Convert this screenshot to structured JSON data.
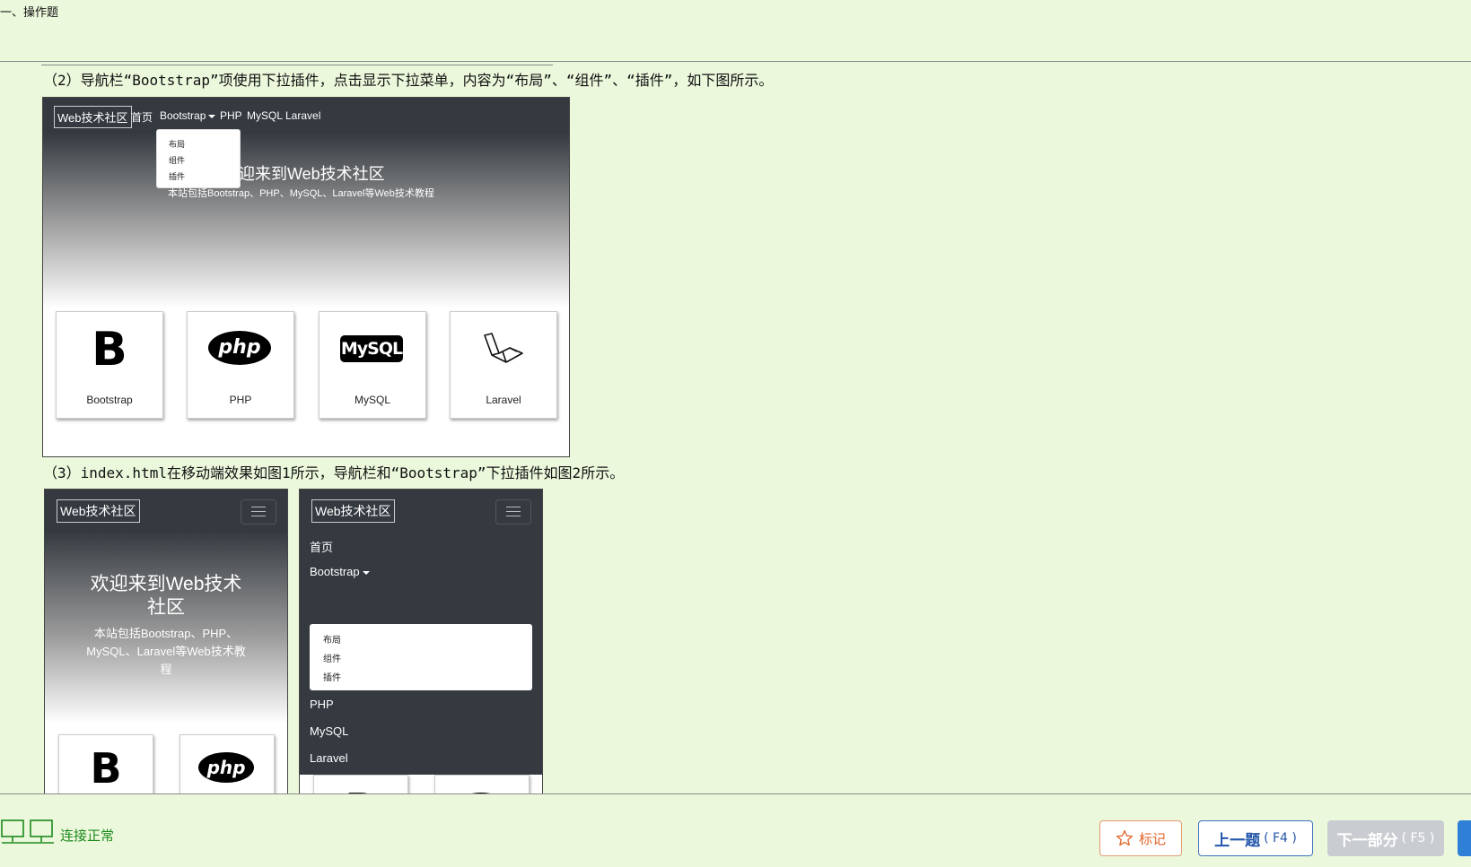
{
  "section_title": "一、操作题",
  "question2_text": "（2）导航栏“Bootstrap”项使用下拉插件，点击显示下拉菜单，内容为“布局”、“组件”、“插件”，如下图所示。",
  "question3_text": "（3）index.html在移动端效果如图1所示，导航栏和“Bootstrap”下拉插件如图2所示。",
  "desktop_shot": {
    "brand": "Web技术社区",
    "nav": [
      "首页",
      "Bootstrap",
      "PHP",
      "MySQL",
      "Laravel"
    ],
    "dropdown": [
      "布局",
      "组件",
      "插件"
    ],
    "hero_title": "迎来到Web技术社区",
    "hero_subtitle": "本站包括Bootstrap、PHP、MySQL、Laravel等Web技术教程",
    "cards": [
      {
        "logo": "B",
        "label": "Bootstrap"
      },
      {
        "logo": "php",
        "label": "PHP"
      },
      {
        "logo": "MySQL",
        "label": "MySQL"
      },
      {
        "logo": "laravel-icon",
        "label": "Laravel"
      }
    ]
  },
  "mobile_shot_1": {
    "brand": "Web技术社区",
    "hero_title_line1": "欢迎来到Web技术",
    "hero_title_line2": "社区",
    "hero_sub_line1": "本站包括Bootstrap、PHP、",
    "hero_sub_line2": "MySQL、Laravel等Web技术教",
    "hero_sub_line3": "程",
    "card_logos": [
      "B",
      "php"
    ]
  },
  "mobile_shot_2": {
    "brand": "Web技术社区",
    "menu": [
      "首页",
      "Bootstrap",
      "PHP",
      "MySQL",
      "Laravel"
    ],
    "dropdown": [
      "布局",
      "组件",
      "插件"
    ],
    "card_logos": [
      "B",
      "php"
    ]
  },
  "status_bar": {
    "connection_text": "连接正常",
    "mark_label": "标记",
    "prev_label": "上一题",
    "prev_key": "( F4 )",
    "next_label": "下一部分",
    "next_key": "( F5 )"
  },
  "colors": {
    "background": "#ecf8dc",
    "navbar": "#343a40",
    "connection": "#1b8a1b",
    "mark_accent": "#e0662a",
    "prev_accent": "#2255aa",
    "next_disabled": "#c9cdd2"
  }
}
